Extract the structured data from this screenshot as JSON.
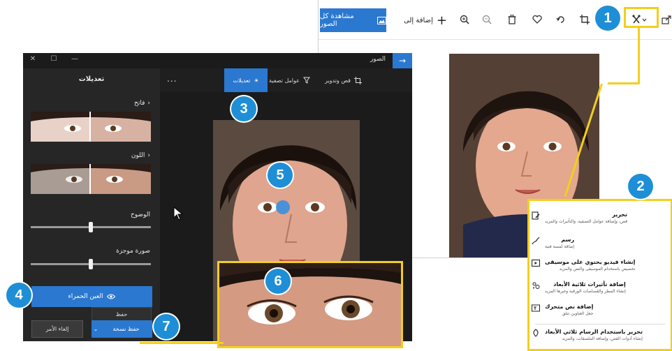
{
  "colors": {
    "accent": "#2b78d0",
    "callout": "#1e8fd6",
    "highlight": "#f2cf1d",
    "editor_bg": "#1b1b1b",
    "panel_bg": "#262626"
  },
  "bg_window": {
    "view_all_label": "مشاهدة كل الصور",
    "add_to_label": "إضافة إلى",
    "toolbar_icons": [
      "zoom-in-icon",
      "zoom-out-icon",
      "delete-icon",
      "favorite-icon",
      "rotate-icon",
      "crop-icon",
      "edit-create-icon",
      "share-icon"
    ]
  },
  "menu": {
    "items": [
      {
        "title": "تحرير",
        "subtitle": "قص، وإضافة عوامل التصفية، والتأثيرات والمزيد",
        "icon": "edit-icon"
      },
      {
        "title": "رسم",
        "subtitle": "إضافة لمسة فنية",
        "icon": "draw-icon"
      },
      {
        "title": "إنشاء فيديو يحتوي على موسيقى",
        "subtitle": "تخصيص باستخدام الموسيقى والنص والمزيد",
        "icon": "video-icon"
      },
      {
        "title": "إضافة تأثيرات ثلاثية الأبعاد",
        "subtitle": "إنشاء المطر والقصاصات الورقية وغيرها المزيد",
        "icon": "effects-3d-icon"
      },
      {
        "title": "إضافة نص متحرك",
        "subtitle": "جعل العناوين تتلق",
        "icon": "animated-text-icon"
      },
      {
        "title": "تحرير باستخدام الرسام ثلاثي الأبعاد",
        "subtitle": "إنشاء أدوات القص، وإضافة الملصقات، والمزيد",
        "icon": "paint3d-icon"
      }
    ]
  },
  "editor": {
    "window_title": "الصور",
    "tabs": {
      "crop": "قص وتدوير",
      "filters": "عوامل تصفية",
      "adjust": "تعديلات"
    },
    "more": "...",
    "panel": {
      "title": "تعديلات",
      "light_label": "فاتح",
      "color_label": "اللون",
      "clarity_label": "الوضوح",
      "vignette_label": "صورة موجزة",
      "clarity_value": 0.5,
      "vignette_value": 0.5,
      "redeye_label": "العين الحمراء",
      "save_label": "حفظ",
      "save_copy_label": "حفظ نسخة",
      "undo_label": "إلغاء الأمر"
    }
  },
  "callouts": [
    "1",
    "2",
    "3",
    "4",
    "5",
    "6",
    "7"
  ]
}
